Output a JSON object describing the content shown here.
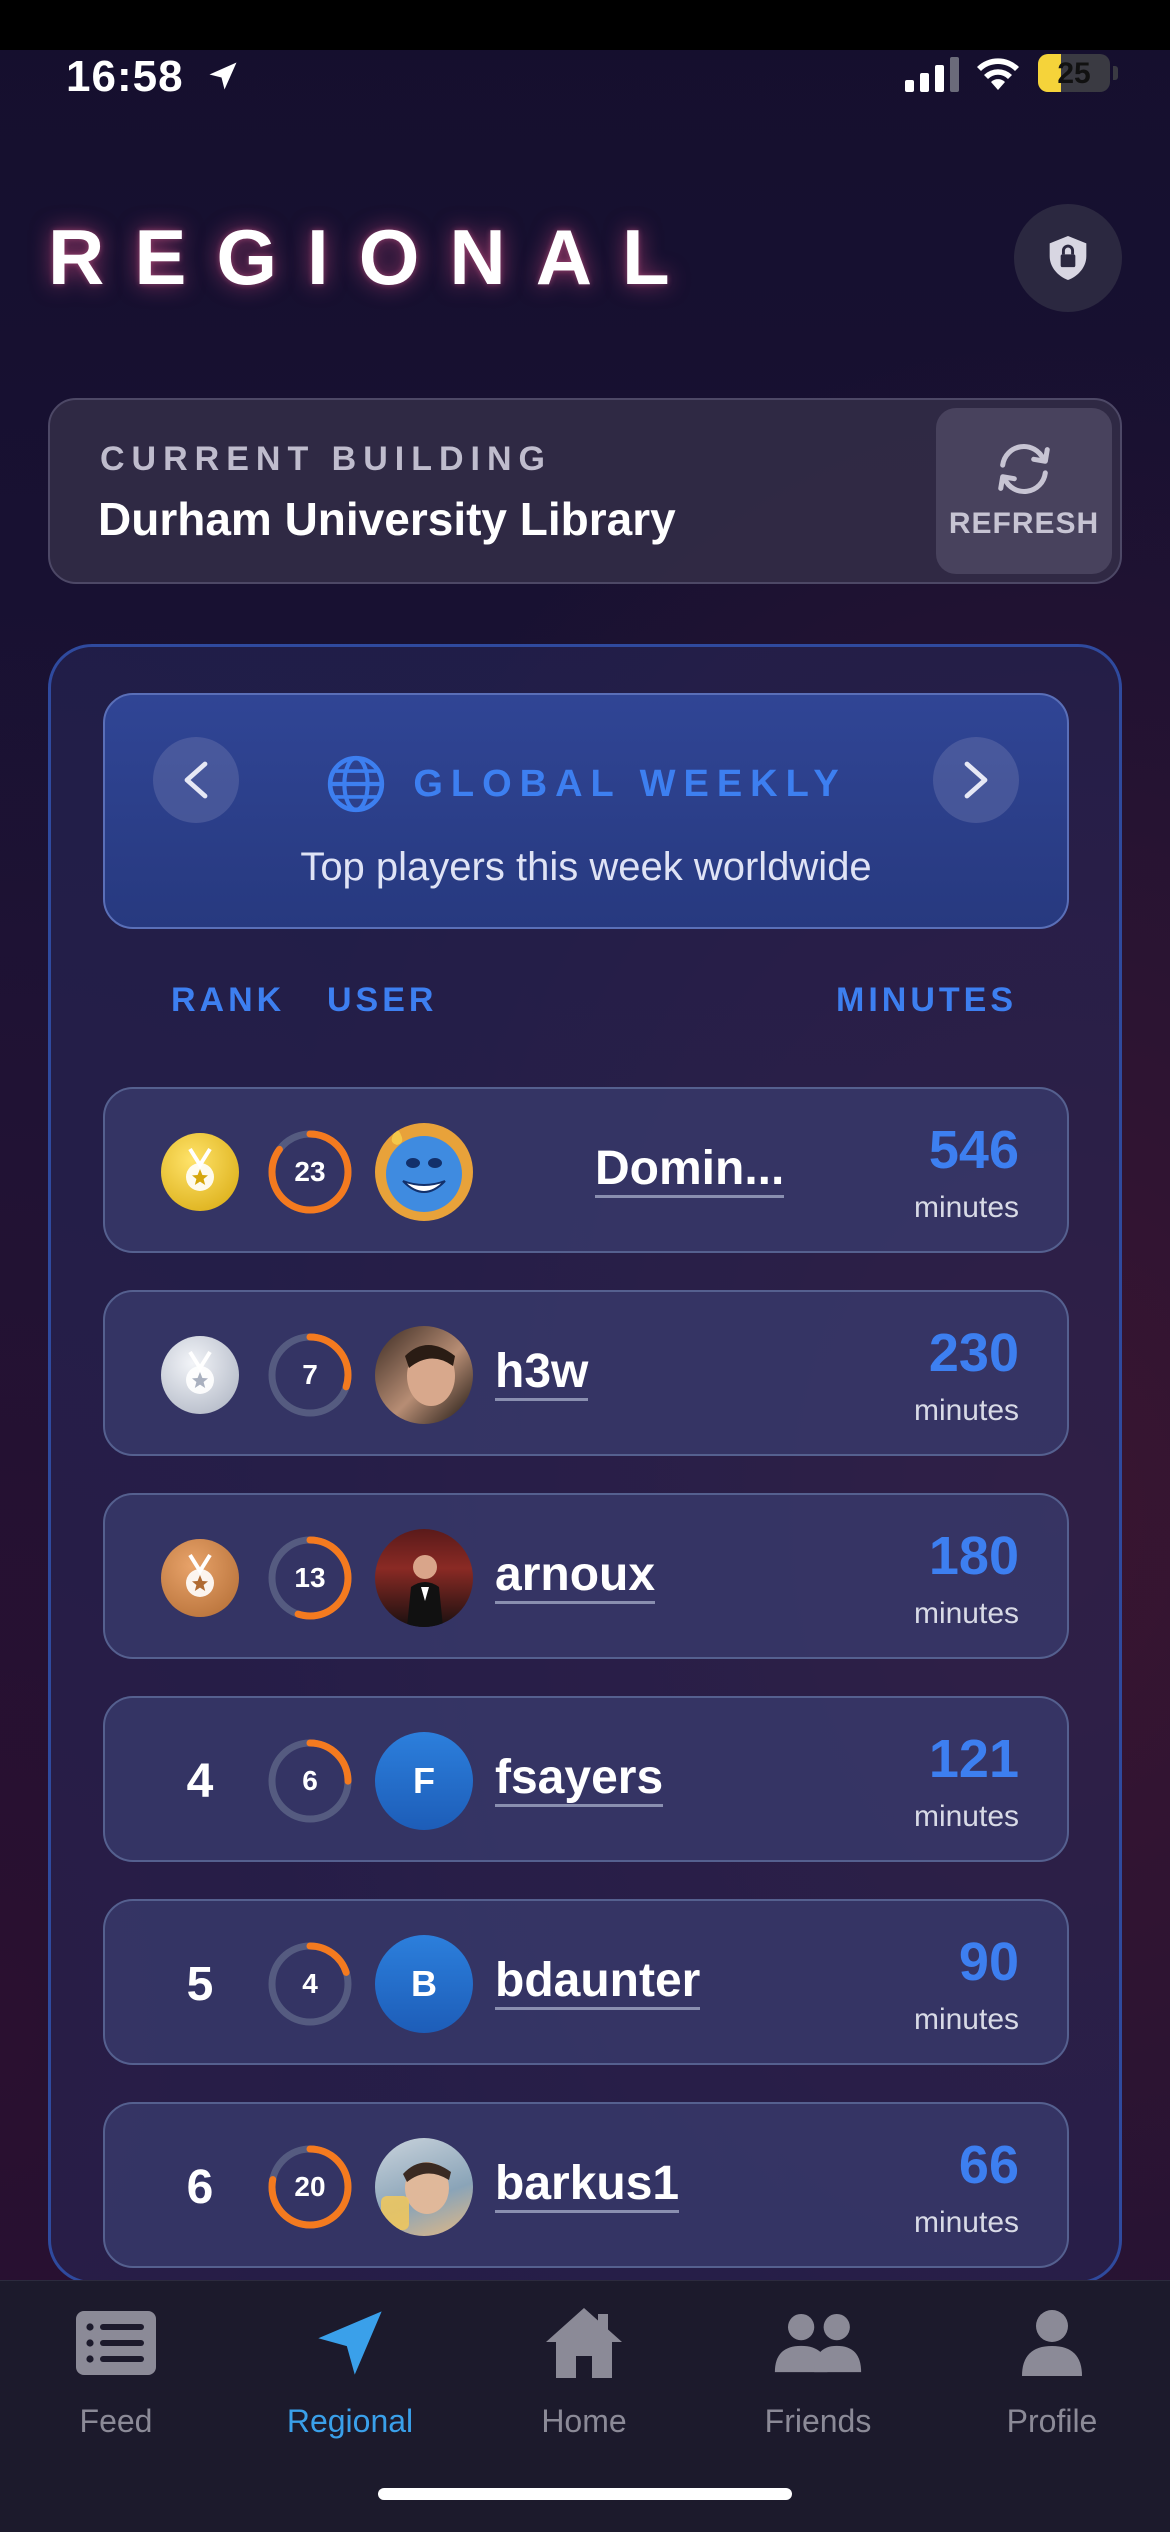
{
  "status_bar": {
    "time": "16:58",
    "battery": "25"
  },
  "page": {
    "title": "REGIONAL"
  },
  "building": {
    "label": "CURRENT BUILDING",
    "name": "Durham University Library",
    "refresh_label": "REFRESH"
  },
  "board": {
    "title": "GLOBAL WEEKLY",
    "subtitle": "Top players this week worldwide",
    "columns": {
      "rank": "RANK",
      "user": "USER",
      "minutes": "MINUTES"
    },
    "rows": [
      {
        "rank": "1",
        "medal": "gold",
        "streak": "23",
        "streak_progress": 0.85,
        "name": "Domin...",
        "avatar": "blue-cartoon-avatar",
        "minutes": "546",
        "unit": "minutes"
      },
      {
        "rank": "2",
        "medal": "silver",
        "streak": "7",
        "streak_progress": 0.3,
        "name": "h3w",
        "avatar": "photo-avatar",
        "minutes": "230",
        "unit": "minutes"
      },
      {
        "rank": "3",
        "medal": "bronze",
        "streak": "13",
        "streak_progress": 0.55,
        "name": "arnoux",
        "avatar": "photo-avatar",
        "minutes": "180",
        "unit": "minutes"
      },
      {
        "rank": "4",
        "medal": "",
        "streak": "6",
        "streak_progress": 0.25,
        "name": "fsayers",
        "avatar_initial": "F",
        "minutes": "121",
        "unit": "minutes"
      },
      {
        "rank": "5",
        "medal": "",
        "streak": "4",
        "streak_progress": 0.2,
        "name": "bdaunter",
        "avatar_initial": "B",
        "minutes": "90",
        "unit": "minutes"
      },
      {
        "rank": "6",
        "medal": "",
        "streak": "20",
        "streak_progress": 0.78,
        "name": "barkus1",
        "avatar": "photo-avatar",
        "minutes": "66",
        "unit": "minutes"
      }
    ]
  },
  "tabs": [
    {
      "label": "Feed",
      "icon": "feed-icon"
    },
    {
      "label": "Regional",
      "icon": "navigation-arrow-icon",
      "active": true
    },
    {
      "label": "Home",
      "icon": "home-icon"
    },
    {
      "label": "Friends",
      "icon": "friends-icon"
    },
    {
      "label": "Profile",
      "icon": "profile-icon"
    }
  ],
  "colors": {
    "accent": "#3d7ff0",
    "streak": "#f47a1f",
    "active_tab": "#3aa0ea"
  }
}
